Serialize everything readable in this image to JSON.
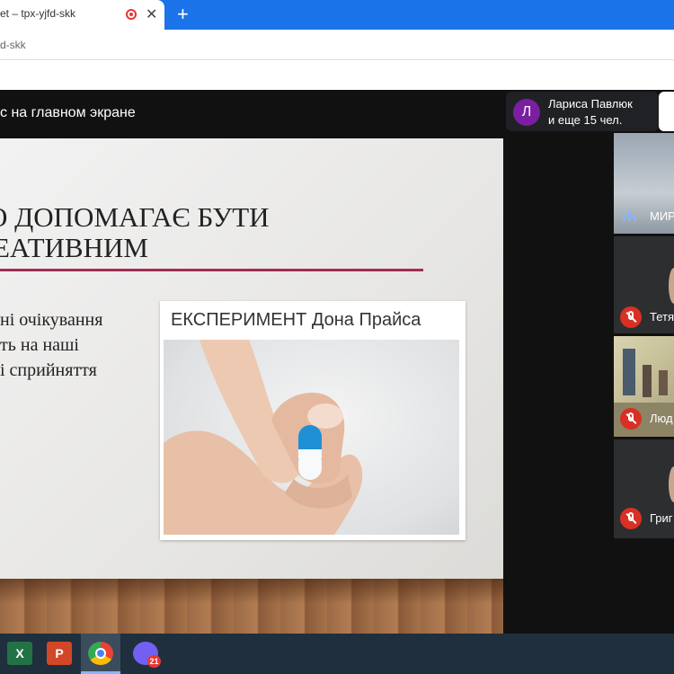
{
  "browser": {
    "tab_title": "et – tpx-yjfd-skk",
    "url_fragment": "d-skk",
    "close_glyph": "✕",
    "new_tab_glyph": "+"
  },
  "meet": {
    "presenting_text": "с на главном экране",
    "people": {
      "avatar_letter": "Л",
      "name": "Лариса Павлюк",
      "more": "и еще 15 чел."
    },
    "participants": [
      {
        "name": "МИР",
        "mic": "speaking"
      },
      {
        "name": "Тетя",
        "mic": "muted"
      },
      {
        "name": "Люд",
        "mic": "muted"
      },
      {
        "name": "Григ",
        "mic": "muted"
      }
    ]
  },
  "slide": {
    "title_line1": "О ДОПОМАГАЄ БУТИ",
    "title_line2": "ЕАТИВНИМ",
    "bullet_lines": [
      "ні очікування",
      "ть на наші",
      "і сприйняття"
    ],
    "card_title": "ЕКСПЕРИМЕНТ Дона Прайса"
  },
  "taskbar": {
    "items": [
      {
        "icon": "excel-icon",
        "label": "X"
      },
      {
        "icon": "powerpoint-icon",
        "label": "P"
      },
      {
        "icon": "chrome-icon",
        "label": ""
      },
      {
        "icon": "viber-icon",
        "label": ""
      }
    ],
    "viber_badge": "21"
  },
  "colors": {
    "chrome_blue": "#1a73e8",
    "title_rule": "#a12d52",
    "mic_off": "#d93025",
    "avatar": "#7b1fa2"
  }
}
